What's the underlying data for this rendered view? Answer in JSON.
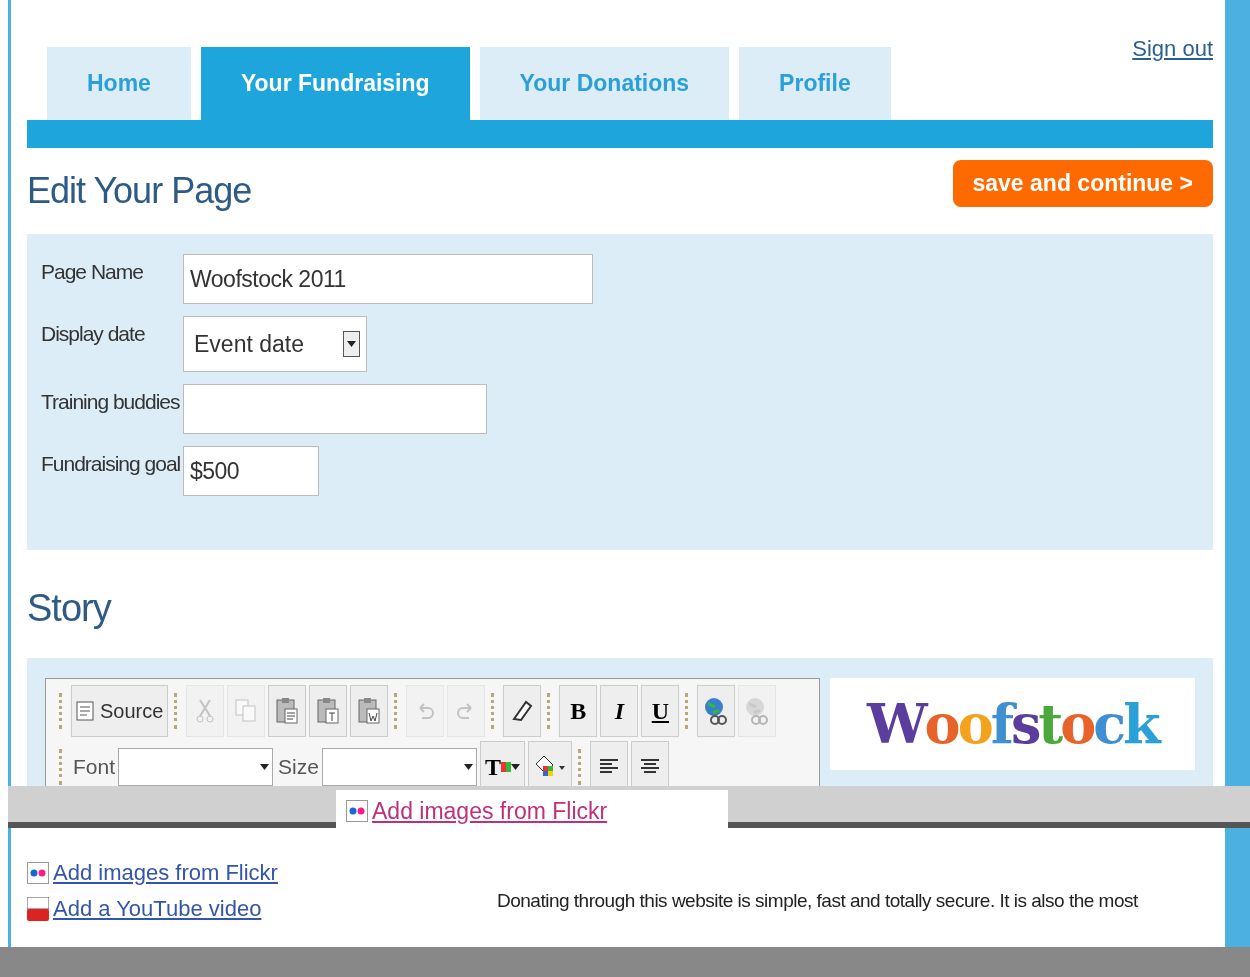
{
  "tabs": [
    {
      "label": "Home",
      "selected": false
    },
    {
      "label": "Your Fundraising",
      "selected": true
    },
    {
      "label": "Your Donations",
      "selected": false
    },
    {
      "label": "Profile",
      "selected": false
    }
  ],
  "sign_out": "Sign out",
  "title": "Edit Your Page",
  "save_button": "save and continue >",
  "form": [
    {
      "label": "Page Name",
      "kind": "text",
      "value": "Woofstock 2011"
    },
    {
      "label": "Display date",
      "kind": "select",
      "value": "Event date"
    },
    {
      "label": "Training buddies",
      "kind": "text"
    },
    {
      "label": "Fundraising goal",
      "kind": "short",
      "value": "$500"
    }
  ],
  "story_title": "Story",
  "toolbar_row1": [
    {
      "kind": "source",
      "label": "Source",
      "disabled": false
    },
    {
      "kind": "sep"
    },
    {
      "kind": "cut",
      "disabled": true
    },
    {
      "kind": "copy",
      "disabled": true
    },
    {
      "kind": "paste",
      "disabled": false
    },
    {
      "kind": "pastetext",
      "disabled": false
    },
    {
      "kind": "pasteword",
      "disabled": false
    },
    {
      "kind": "sep"
    },
    {
      "kind": "undo",
      "disabled": true
    },
    {
      "kind": "redo",
      "disabled": true
    },
    {
      "kind": "sep"
    },
    {
      "kind": "eraser",
      "disabled": false
    },
    {
      "kind": "sep"
    },
    {
      "kind": "bold",
      "label": "B",
      "disabled": false
    },
    {
      "kind": "italic",
      "label": "I",
      "disabled": false
    },
    {
      "kind": "underline",
      "label": "U",
      "disabled": false
    },
    {
      "kind": "sep"
    },
    {
      "kind": "link",
      "disabled": false
    },
    {
      "kind": "unlink",
      "disabled": true
    }
  ],
  "toolbar_row2": [
    {
      "kind": "combo",
      "label": "Font"
    },
    {
      "kind": "combo",
      "label": "Size"
    },
    {
      "kind": "textcolor",
      "label": "T"
    },
    {
      "kind": "bgcolor"
    },
    {
      "kind": "sep"
    },
    {
      "kind": "alignleft"
    },
    {
      "kind": "aligncenter"
    }
  ],
  "logo": {
    "parts": [
      {
        "text": "W",
        "color": "#5b3d9e"
      },
      {
        "text": "o",
        "color": "#e8632a"
      },
      {
        "text": "o",
        "color": "#f3a21b"
      },
      {
        "text": "f",
        "color": "#3f8fd2"
      },
      {
        "text": "s",
        "color": "#5b3d9e"
      },
      {
        "text": "t",
        "color": "#4aa83d"
      },
      {
        "text": "o",
        "color": "#e8632a"
      },
      {
        "text": "c",
        "color": "#3f8fd2"
      },
      {
        "text": "k",
        "color": "#2a9fd8"
      }
    ]
  },
  "popup_link": "Add images from Flickr",
  "side_links": [
    {
      "kind": "flickr",
      "label": "Add images from Flickr"
    },
    {
      "kind": "youtube",
      "label": "Add a YouTube video"
    }
  ],
  "story_text": "Donating through this website is simple, fast and totally secure. It is also the most"
}
